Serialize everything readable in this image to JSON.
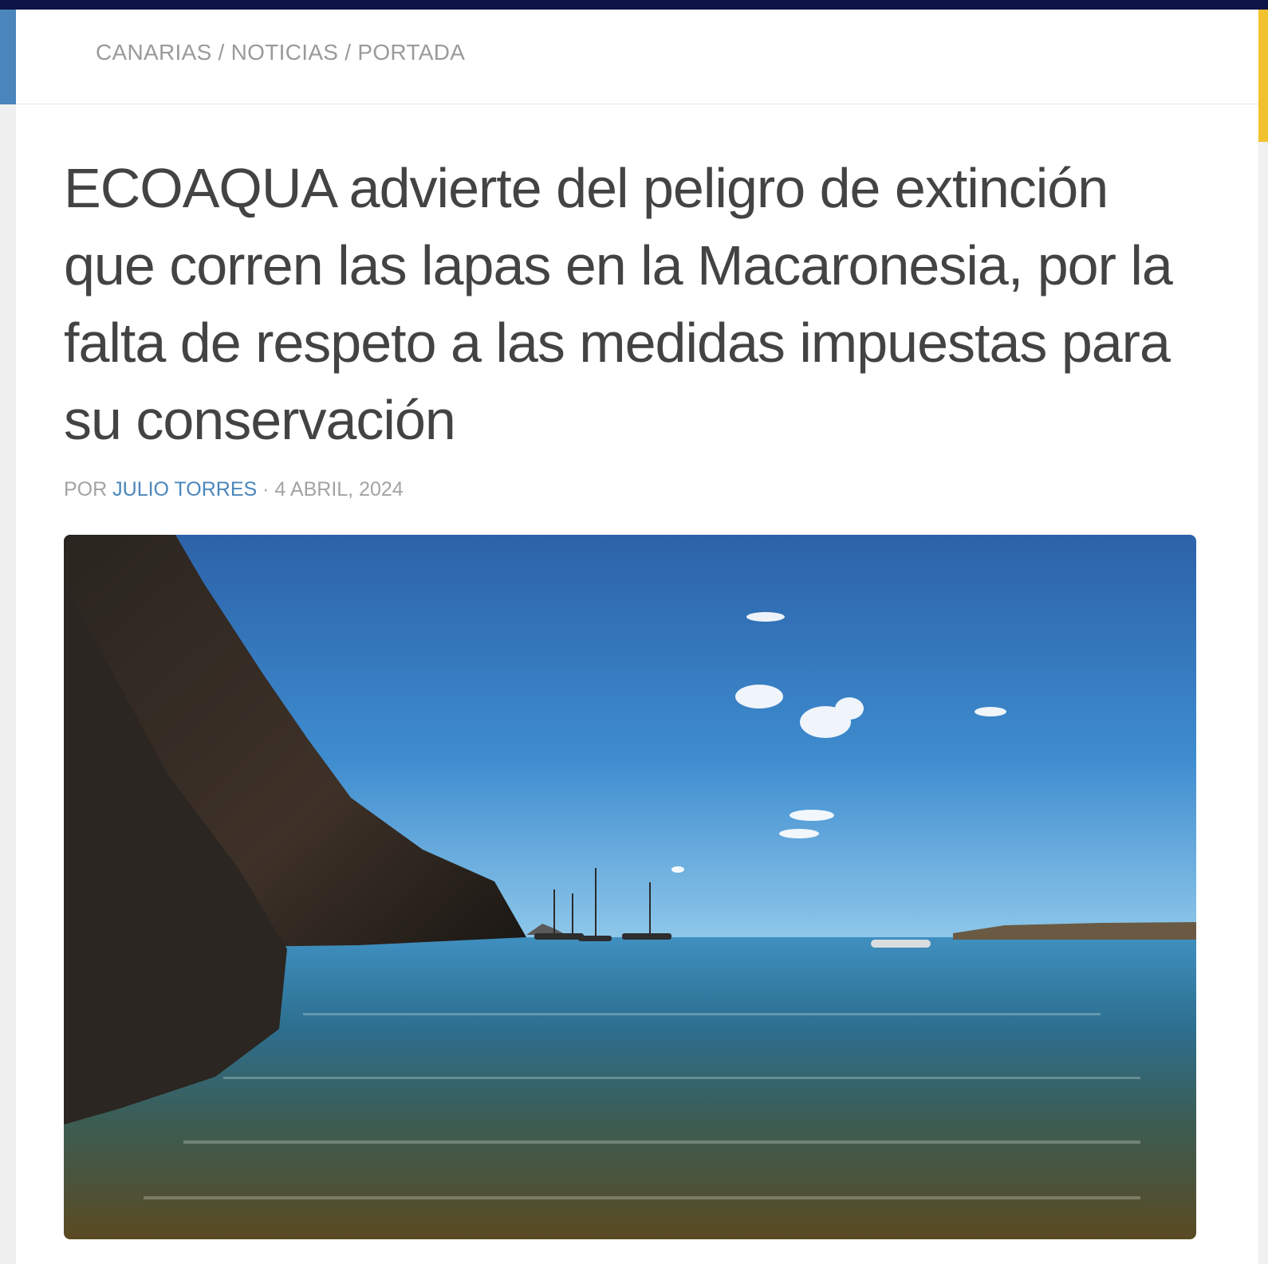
{
  "breadcrumb": {
    "items": [
      "CANARIAS",
      "NOTICIAS",
      "PORTADA"
    ],
    "separator": "/"
  },
  "article": {
    "headline": "ECOAQUA advierte del peligro de extinción que corren las lapas en la Macaronesia, por la falta de respeto a las medidas impuestas para su conservación",
    "byline_prefix": "POR",
    "author": "JULIO TORRES",
    "meta_separator": "·",
    "date": "4 ABRIL, 2024"
  },
  "colors": {
    "topbar": "#0c1447",
    "accent_blue": "#4a86bb",
    "accent_yellow": "#f2c12e",
    "headline_text": "#434343",
    "muted_text": "#9a9a9a"
  },
  "icons": {
    "hero": "coastal-photo"
  }
}
